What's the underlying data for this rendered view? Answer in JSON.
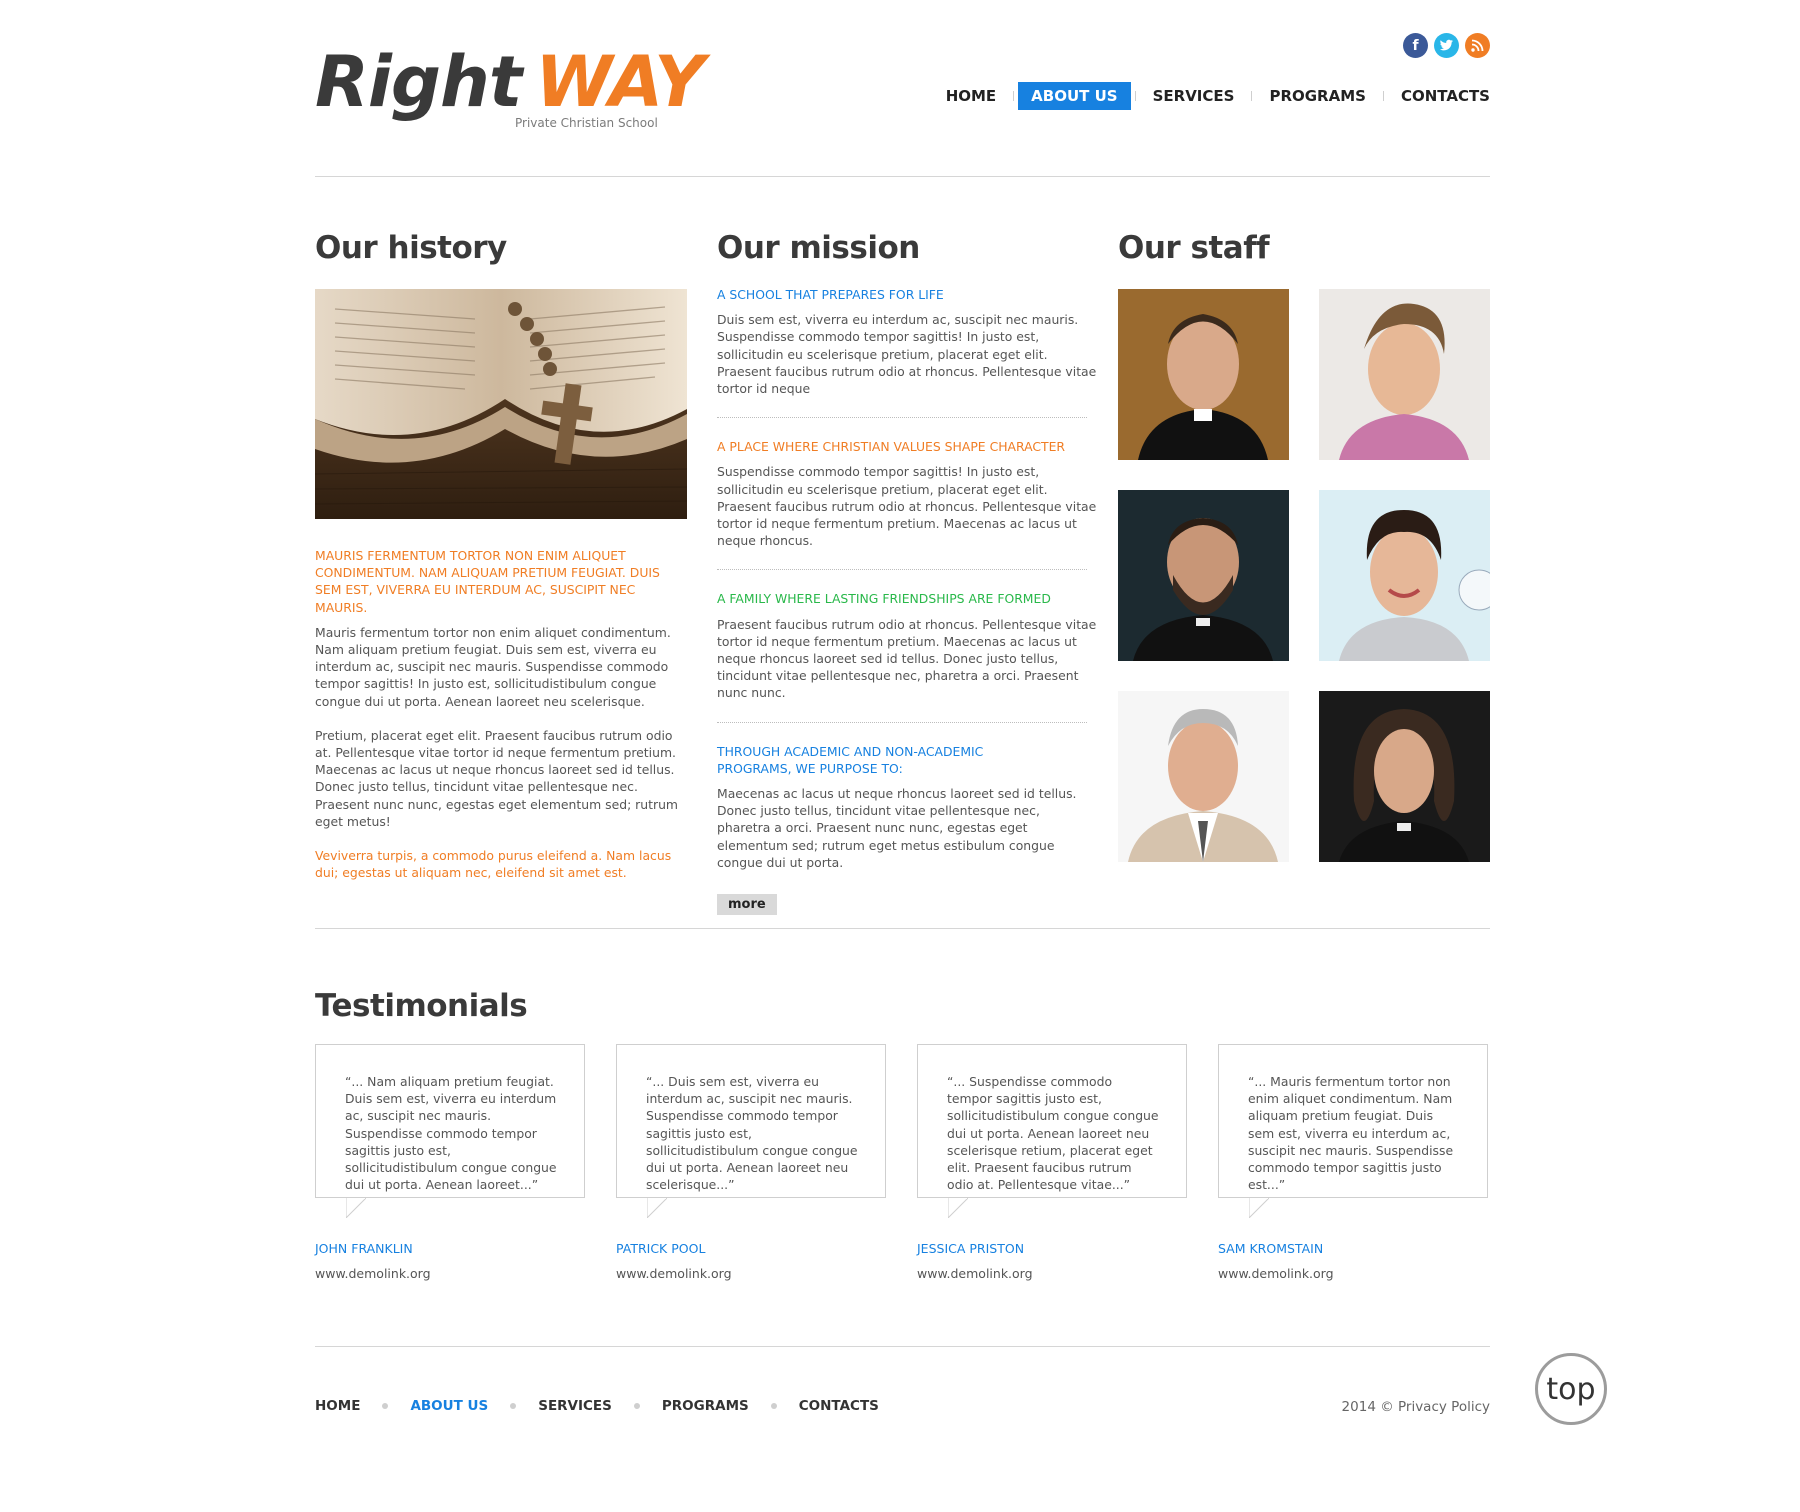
{
  "brand": {
    "word1": "Right",
    "word2": "WAY",
    "tagline": "Private Christian School"
  },
  "social": [
    {
      "icon": "facebook-icon",
      "glyph": "f",
      "color": "#3b5998"
    },
    {
      "icon": "twitter-icon",
      "glyph": "t",
      "color": "#29b6e8"
    },
    {
      "icon": "rss-icon",
      "glyph": "r",
      "color": "#f07d24"
    }
  ],
  "nav": [
    "HOME",
    "ABOUT US",
    "SERVICES",
    "PROGRAMS",
    "CONTACTS"
  ],
  "nav_active": "ABOUT US",
  "history": {
    "title": "Our history",
    "lead": "MAURIS FERMENTUM TORTOR NON ENIM ALIQUET CONDIMENTUM. NAM ALIQUAM PRETIUM FEUGIAT. DUIS SEM EST, VIVERRA EU INTERDUM AC, SUSCIPIT NEC MAURIS.",
    "p1": "Mauris fermentum tortor non enim aliquet condimentum. Nam aliquam pretium feugiat. Duis sem est, viverra eu interdum ac, suscipit nec mauris. Suspendisse commodo tempor sagittis! In justo est, sollicitudistibulum congue congue dui ut porta. Aenean laoreet neu scelerisque.",
    "p2": "Pretium, placerat eget elit. Praesent faucibus rutrum odio at. Pellentesque vitae tortor id neque fermentum pretium. Maecenas ac lacus ut neque rhoncus laoreet sed id tellus. Donec justo tellus, tincidunt vitae pellentesque nec. Praesent nunc nunc, egestas eget elementum sed; rutrum eget metus!",
    "p3": "Veviverra turpis, a commodo purus eleifend a. Nam lacus dui; egestas ut aliquam nec, eleifend sit amet est."
  },
  "mission": {
    "title": "Our mission",
    "items": [
      {
        "heading": "A SCHOOL THAT PREPARES FOR LIFE",
        "text": "Duis sem est, viverra eu interdum ac, suscipit nec mauris. Suspendisse commodo tempor sagittis! In justo est, sollicitudin eu scelerisque pretium, placerat eget elit. Praesent faucibus rutrum odio at rhoncus. Pellentesque vitae tortor id neque"
      },
      {
        "heading": "A PLACE WHERE CHRISTIAN VALUES SHAPE CHARACTER",
        "text": "Suspendisse commodo tempor sagittis! In justo est, sollicitudin eu scelerisque pretium, placerat eget elit. Praesent faucibus rutrum odio at rhoncus. Pellentesque vitae tortor id neque fermentum pretium. Maecenas ac lacus ut neque rhoncus."
      },
      {
        "heading": "A FAMILY WHERE LASTING FRIENDSHIPS ARE FORMED",
        "text": "Praesent faucibus rutrum odio at rhoncus. Pellentesque vitae tortor id neque fermentum pretium. Maecenas ac lacus ut neque rhoncus laoreet sed id tellus. Donec justo tellus, tincidunt vitae pellentesque nec, pharetra a orci. Praesent nunc nunc."
      },
      {
        "heading": "THROUGH ACADEMIC AND NON-ACADEMIC PROGRAMS, WE PURPOSE TO:",
        "text": "Maecenas ac lacus ut neque rhoncus laoreet sed id tellus. Donec justo tellus, tincidunt vitae pellentesque nec, pharetra a orci. Praesent nunc nunc, egestas eget elementum sed; rutrum eget metus estibulum congue congue dui ut porta."
      }
    ],
    "more": "more"
  },
  "staff": {
    "title": "Our staff"
  },
  "testimonials": {
    "title": "Testimonials",
    "items": [
      {
        "quote": "“... Nam aliquam pretium feugiat. Duis sem est, viverra eu interdum ac, suscipit nec mauris. Suspendisse commodo tempor sagittis justo est, sollicitudistibulum congue congue dui ut porta. Aenean laoreet...”",
        "name": "JOHN FRANKLIN",
        "link": "www.demolink.org"
      },
      {
        "quote": "“... Duis sem est, viverra eu interdum ac, suscipit nec mauris. Suspendisse commodo tempor sagittis justo est, sollicitudistibulum congue congue dui ut porta. Aenean laoreet neu scelerisque...”",
        "name": "PATRICK POOL",
        "link": "www.demolink.org"
      },
      {
        "quote": "“... Suspendisse commodo tempor sagittis justo est, sollicitudistibulum congue congue dui ut porta. Aenean laoreet neu scelerisque retium, placerat eget elit. Praesent faucibus rutrum odio at. Pellentesque vitae...”",
        "name": "JESSICA PRISTON",
        "link": "www.demolink.org"
      },
      {
        "quote": "“... Mauris fermentum tortor non enim aliquet condimentum. Nam aliquam pretium feugiat. Duis sem est, viverra eu interdum ac, suscipit nec mauris. Suspendisse commodo tempor sagittis justo est...”",
        "name": "SAM KROMSTAIN",
        "link": "www.demolink.org"
      }
    ]
  },
  "footer": {
    "nav": [
      "HOME",
      "ABOUT US",
      "SERVICES",
      "PROGRAMS",
      "CONTACTS"
    ],
    "active": "ABOUT US",
    "copyright": "2014 © Privacy Policy"
  },
  "top_button": "top",
  "colors": {
    "accent_blue": "#1781e0",
    "accent_orange": "#f07d24",
    "accent_green": "#29b84a",
    "text_dark": "#3a3a3a"
  }
}
